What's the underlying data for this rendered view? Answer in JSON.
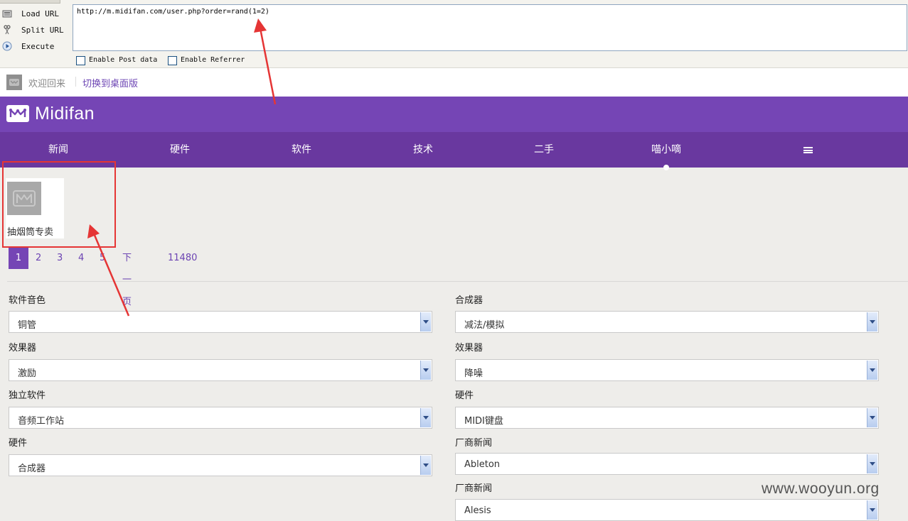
{
  "hackbar": {
    "load_url": "Load URL",
    "split_url": "Split URL",
    "execute": "Execute",
    "url_value": "http://m.midifan.com/user.php?order=rand(1=2)",
    "enable_post": "Enable Post data",
    "enable_referrer": "Enable Referrer"
  },
  "welcome": {
    "text": "欢迎回来",
    "switch_link": "切换到桌面版"
  },
  "brand": {
    "logo_text": "Midifan"
  },
  "nav": [
    "新闻",
    "硬件",
    "软件",
    "技术",
    "二手",
    "喵小嘀"
  ],
  "user_card": {
    "name": "抽烟筒专卖"
  },
  "pager": {
    "pages": [
      "1",
      "2",
      "3",
      "4",
      "5"
    ],
    "next": "下一页",
    "total": "11480",
    "current": "1"
  },
  "filters": {
    "left": [
      {
        "label": "软件音色",
        "value": "铜管"
      },
      {
        "label": "效果器",
        "value": "激励"
      },
      {
        "label": "独立软件",
        "value": "音频工作站"
      },
      {
        "label": "硬件",
        "value": "合成器"
      }
    ],
    "right": [
      {
        "label": "合成器",
        "value": "减法/模拟"
      },
      {
        "label": "效果器",
        "value": "降噪"
      },
      {
        "label": "硬件",
        "value": "MIDI键盘"
      },
      {
        "label": "厂商新闻",
        "value": "Ableton"
      },
      {
        "label": "厂商新闻",
        "value": "Alesis"
      }
    ]
  },
  "watermark": "www.wooyun.org",
  "colors": {
    "brand_purple": "#7545b5",
    "nav_purple": "#69389f",
    "annotation_red": "#e53535"
  }
}
